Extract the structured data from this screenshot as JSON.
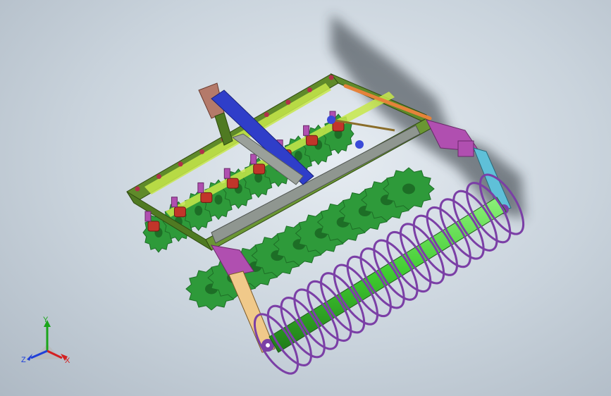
{
  "viewport": {
    "background_top": "#e6ecf2",
    "background_bottom": "#aeb9c4"
  },
  "model": {
    "colors": {
      "frame": "#5f8a2a",
      "frame_dark": "#3f6218",
      "disc": "#2e9a3a",
      "disc_dark": "#1d6e26",
      "hitch": "#2f3ec9",
      "bracket": "#b04fb0",
      "spring": "#c1352a",
      "roller_coil": "#7b3fa6",
      "roller_core": "#3ecb2f",
      "link_arm": "#f0c98a",
      "rod": "#e5823a",
      "shadow": "#2b3138"
    },
    "front_gang_discs": 10,
    "rear_gang_discs": 10,
    "roller_coils": 18
  },
  "triad": {
    "x_label": "X",
    "y_label": "Y",
    "z_label": "Z",
    "x_color": "#d42020",
    "y_color": "#1aa51a",
    "z_color": "#2040d8"
  }
}
